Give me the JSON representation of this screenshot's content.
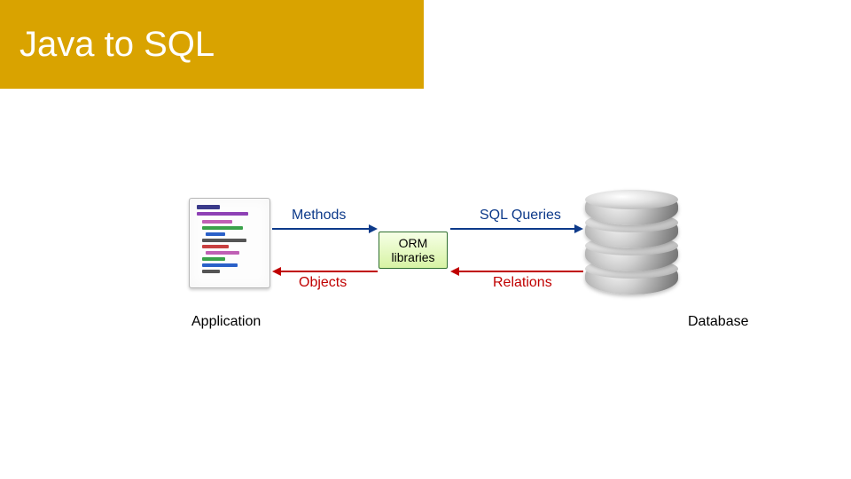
{
  "title": "Java to SQL",
  "nodes": {
    "application": "Application",
    "database": "Database",
    "orm": "ORM libraries"
  },
  "arrows": {
    "methods": "Methods",
    "objects": "Objects",
    "sql_queries": "SQL Queries",
    "relations": "Relations"
  }
}
